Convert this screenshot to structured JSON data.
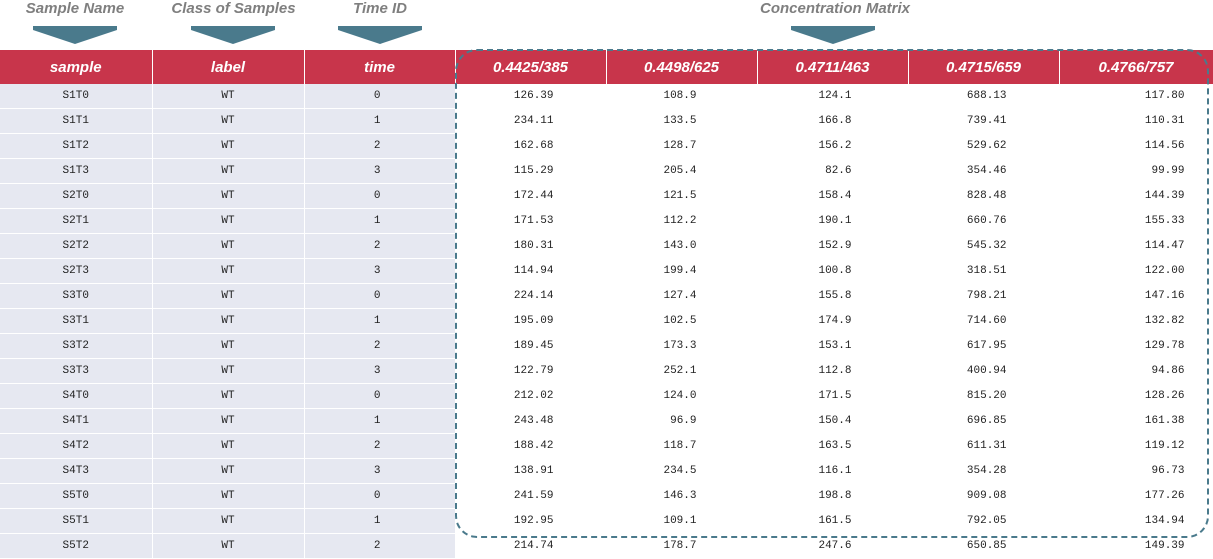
{
  "annotations": {
    "sample_name": "Sample Name",
    "class_of_samples": "Class of Samples",
    "time_id": "Time ID",
    "concentration_matrix": "Concentration Matrix",
    "arrow_color": "#4a7a8c"
  },
  "table": {
    "header_color": "#c8354b",
    "meta_background": "#e6e8f1",
    "columns": [
      "sample",
      "label",
      "time",
      "0.4425/385",
      "0.4498/625",
      "0.4711/463",
      "0.4715/659",
      "0.4766/757"
    ],
    "rows": [
      [
        "S1T0",
        "WT",
        "0",
        "126.39",
        "108.9",
        "124.1",
        "688.13",
        "117.80"
      ],
      [
        "S1T1",
        "WT",
        "1",
        "234.11",
        "133.5",
        "166.8",
        "739.41",
        "110.31"
      ],
      [
        "S1T2",
        "WT",
        "2",
        "162.68",
        "128.7",
        "156.2",
        "529.62",
        "114.56"
      ],
      [
        "S1T3",
        "WT",
        "3",
        "115.29",
        "205.4",
        "82.6",
        "354.46",
        "99.99"
      ],
      [
        "S2T0",
        "WT",
        "0",
        "172.44",
        "121.5",
        "158.4",
        "828.48",
        "144.39"
      ],
      [
        "S2T1",
        "WT",
        "1",
        "171.53",
        "112.2",
        "190.1",
        "660.76",
        "155.33"
      ],
      [
        "S2T2",
        "WT",
        "2",
        "180.31",
        "143.0",
        "152.9",
        "545.32",
        "114.47"
      ],
      [
        "S2T3",
        "WT",
        "3",
        "114.94",
        "199.4",
        "100.8",
        "318.51",
        "122.00"
      ],
      [
        "S3T0",
        "WT",
        "0",
        "224.14",
        "127.4",
        "155.8",
        "798.21",
        "147.16"
      ],
      [
        "S3T1",
        "WT",
        "1",
        "195.09",
        "102.5",
        "174.9",
        "714.60",
        "132.82"
      ],
      [
        "S3T2",
        "WT",
        "2",
        "189.45",
        "173.3",
        "153.1",
        "617.95",
        "129.78"
      ],
      [
        "S3T3",
        "WT",
        "3",
        "122.79",
        "252.1",
        "112.8",
        "400.94",
        "94.86"
      ],
      [
        "S4T0",
        "WT",
        "0",
        "212.02",
        "124.0",
        "171.5",
        "815.20",
        "128.26"
      ],
      [
        "S4T1",
        "WT",
        "1",
        "243.48",
        "96.9",
        "150.4",
        "696.85",
        "161.38"
      ],
      [
        "S4T2",
        "WT",
        "2",
        "188.42",
        "118.7",
        "163.5",
        "611.31",
        "119.12"
      ],
      [
        "S4T3",
        "WT",
        "3",
        "138.91",
        "234.5",
        "116.1",
        "354.28",
        "96.73"
      ],
      [
        "S5T0",
        "WT",
        "0",
        "241.59",
        "146.3",
        "198.8",
        "909.08",
        "177.26"
      ],
      [
        "S5T1",
        "WT",
        "1",
        "192.95",
        "109.1",
        "161.5",
        "792.05",
        "134.94"
      ],
      [
        "S5T2",
        "WT",
        "2",
        "214.74",
        "178.7",
        "247.6",
        "650.85",
        "149.39"
      ]
    ]
  }
}
